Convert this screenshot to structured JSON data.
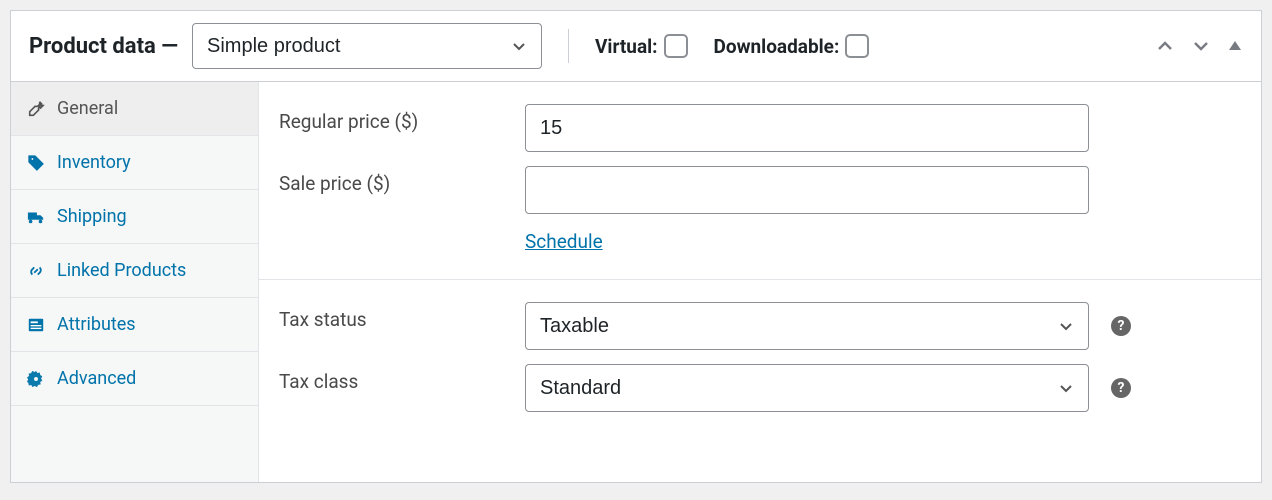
{
  "header": {
    "title": "Product data —",
    "product_type": "Simple product",
    "virtual_label": "Virtual:",
    "downloadable_label": "Downloadable:"
  },
  "sidebar": {
    "items": [
      {
        "label": "General"
      },
      {
        "label": "Inventory"
      },
      {
        "label": "Shipping"
      },
      {
        "label": "Linked Products"
      },
      {
        "label": "Attributes"
      },
      {
        "label": "Advanced"
      }
    ]
  },
  "fields": {
    "regular_price_label": "Regular price ($)",
    "regular_price_value": "15",
    "sale_price_label": "Sale price ($)",
    "sale_price_value": "",
    "schedule_label": "Schedule",
    "tax_status_label": "Tax status",
    "tax_status_value": "Taxable",
    "tax_class_label": "Tax class",
    "tax_class_value": "Standard"
  },
  "help_glyph": "?"
}
